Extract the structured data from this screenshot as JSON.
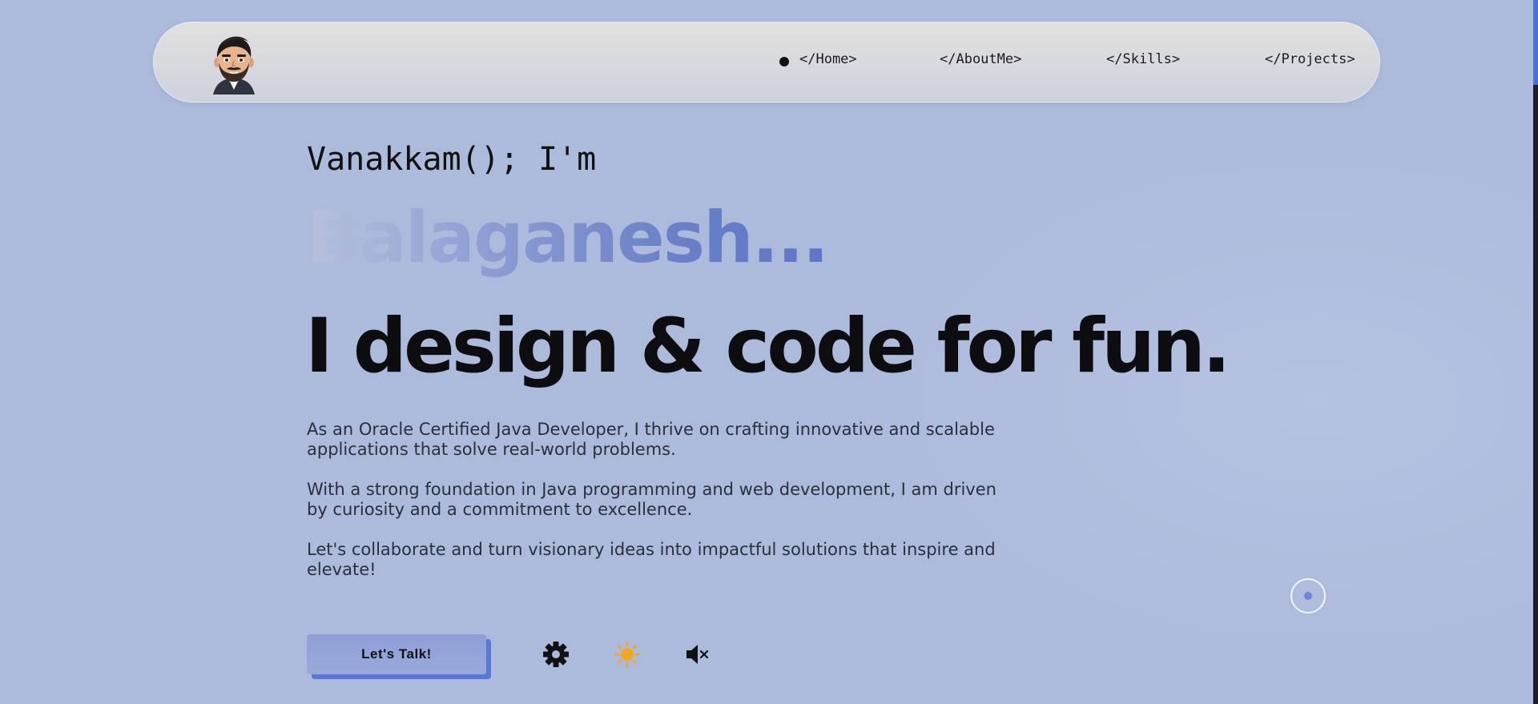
{
  "nav": {
    "items": [
      {
        "label": "</Home>",
        "active": true
      },
      {
        "label": "</AboutMe>",
        "active": false
      },
      {
        "label": "</Skills>",
        "active": false
      },
      {
        "label": "</Projects>",
        "active": false
      }
    ]
  },
  "hero": {
    "greeting": "Vanakkam(); I'm",
    "name": "Balaganesh...",
    "tagline": "I design & code for fun.",
    "bio": [
      "As an Oracle Certified Java Developer, I thrive on crafting innovative and scalable applications that solve real-world problems.",
      "With a strong foundation in Java programming and web development, I am driven by curiosity and a commitment to excellence.",
      "Let's collaborate and turn visionary ideas into impactful solutions that inspire and elevate!"
    ],
    "cta_label": "Let's Talk!"
  },
  "controls": {
    "settings_icon": "gear-icon",
    "theme_icon": "sun-icon",
    "sound_icon": "speaker-muted-icon"
  },
  "colors": {
    "background": "#acbadc",
    "accent": "#5a78d6",
    "sun": "#f5a623"
  }
}
